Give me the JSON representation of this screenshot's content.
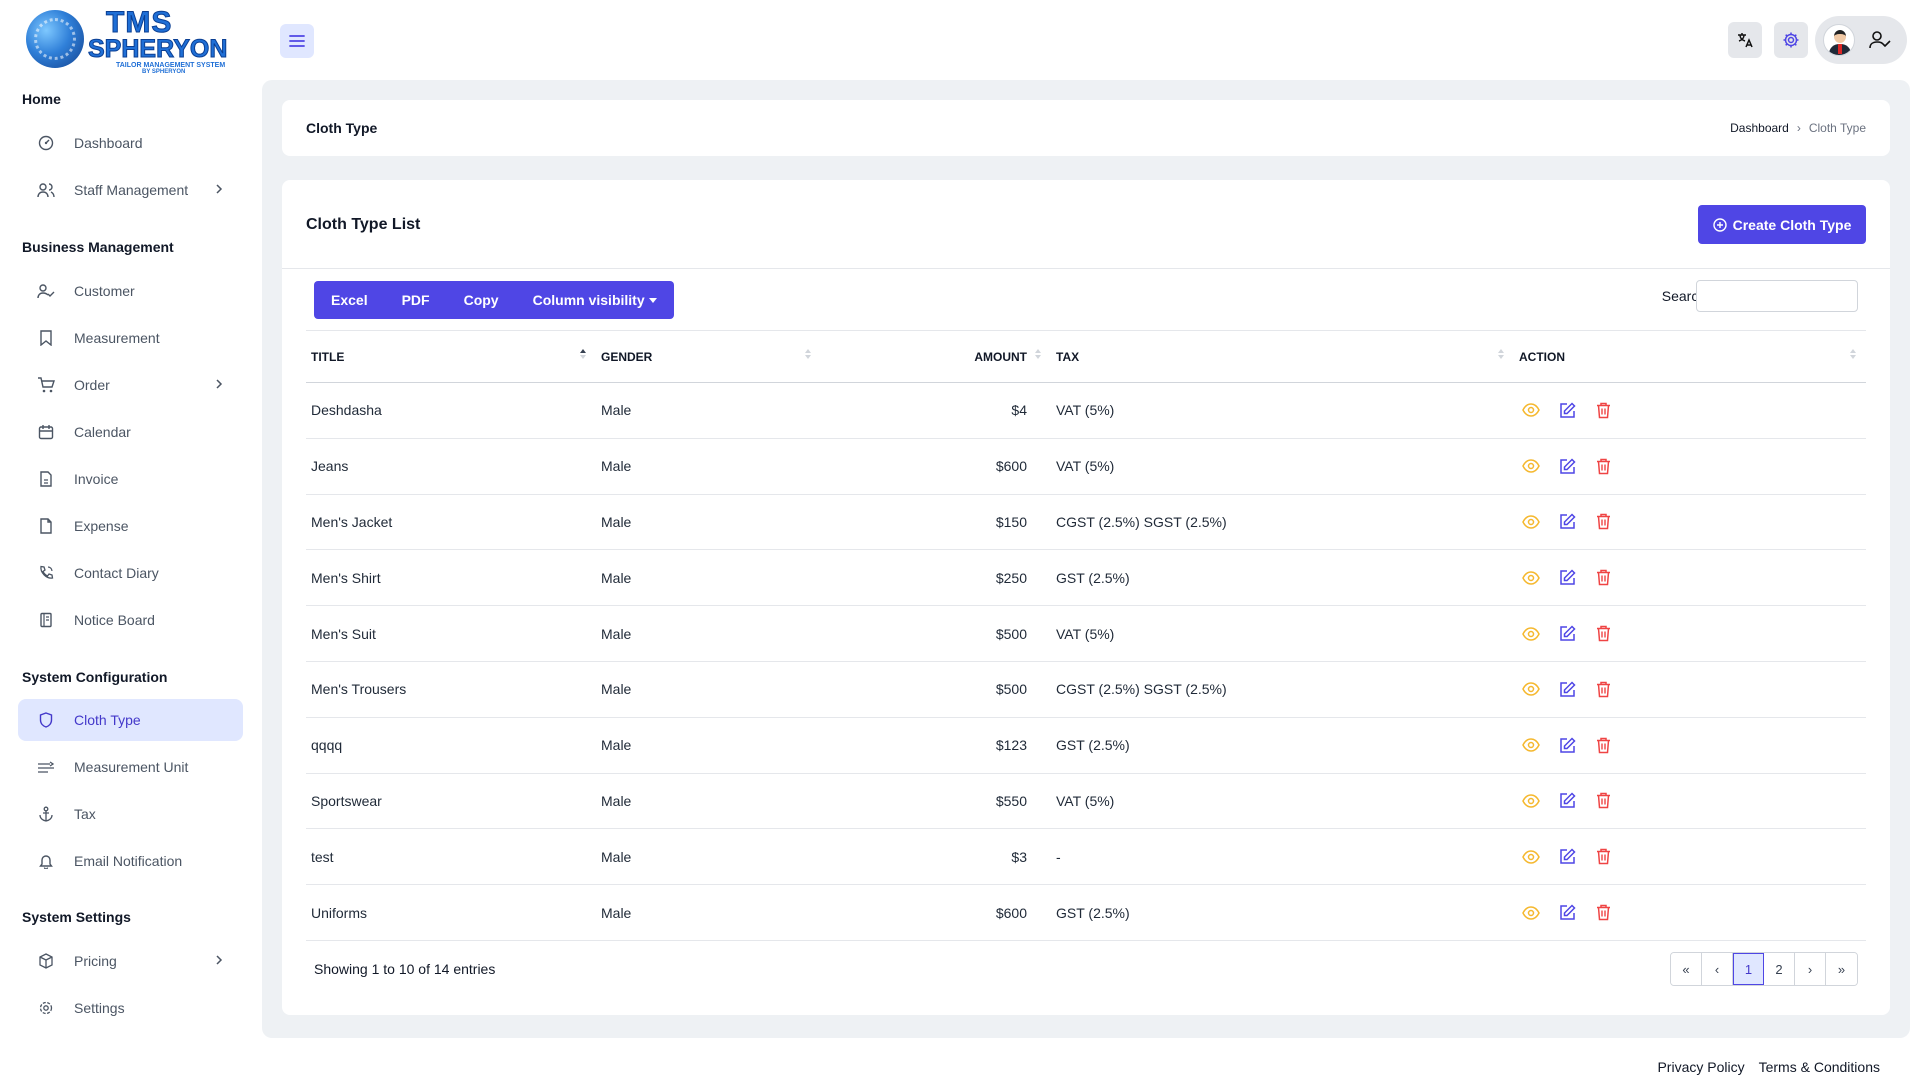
{
  "logo": {
    "title": "TMS",
    "subtitle": "SPHERYON",
    "tagline": "TAILOR MANAGEMENT SYSTEM",
    "byline": "BY SPHERYON"
  },
  "header": {
    "icons": [
      "menu-icon",
      "translate-icon",
      "gear-icon",
      "user-check-icon"
    ]
  },
  "sidebar": {
    "sections": [
      {
        "title": "Home",
        "items": [
          {
            "label": "Dashboard",
            "icon": "dashboard-icon"
          },
          {
            "label": "Staff Management",
            "icon": "users-icon",
            "has_submenu": true
          }
        ]
      },
      {
        "title": "Business Management",
        "items": [
          {
            "label": "Customer",
            "icon": "user-check-icon"
          },
          {
            "label": "Measurement",
            "icon": "bookmark-icon"
          },
          {
            "label": "Order",
            "icon": "cart-icon",
            "has_submenu": true
          },
          {
            "label": "Calendar",
            "icon": "calendar-icon"
          },
          {
            "label": "Invoice",
            "icon": "invoice-icon"
          },
          {
            "label": "Expense",
            "icon": "file-icon"
          },
          {
            "label": "Contact Diary",
            "icon": "phone-icon"
          },
          {
            "label": "Notice Board",
            "icon": "notice-icon"
          }
        ]
      },
      {
        "title": "System Configuration",
        "items": [
          {
            "label": "Cloth Type",
            "icon": "shield-icon",
            "active": true
          },
          {
            "label": "Measurement Unit",
            "icon": "ruler-icon"
          },
          {
            "label": "Tax",
            "icon": "anchor-icon"
          },
          {
            "label": "Email Notification",
            "icon": "bell-icon"
          }
        ]
      },
      {
        "title": "System Settings",
        "items": [
          {
            "label": "Pricing",
            "icon": "box-icon",
            "has_submenu": true
          },
          {
            "label": "Settings",
            "icon": "settings-icon"
          }
        ]
      }
    ]
  },
  "page": {
    "title": "Cloth Type",
    "breadcrumb": [
      "Dashboard",
      "Cloth Type"
    ]
  },
  "list": {
    "title": "Cloth Type List",
    "create_label": "Create Cloth Type",
    "export_buttons": [
      "Excel",
      "PDF",
      "Copy",
      "Column visibility"
    ],
    "search_label": "Search:",
    "search_value": "",
    "columns": [
      "TITLE",
      "GENDER",
      "AMOUNT",
      "TAX",
      "ACTION"
    ],
    "rows": [
      {
        "title": "Deshdasha",
        "gender": "Male",
        "amount": "$4",
        "tax": "VAT (5%)"
      },
      {
        "title": "Jeans",
        "gender": "Male",
        "amount": "$600",
        "tax": "VAT (5%)"
      },
      {
        "title": "Men's Jacket",
        "gender": "Male",
        "amount": "$150",
        "tax": "CGST (2.5%) SGST (2.5%)"
      },
      {
        "title": "Men's Shirt",
        "gender": "Male",
        "amount": "$250",
        "tax": "GST (2.5%)"
      },
      {
        "title": "Men's Suit",
        "gender": "Male",
        "amount": "$500",
        "tax": "VAT (5%)"
      },
      {
        "title": "Men's Trousers",
        "gender": "Male",
        "amount": "$500",
        "tax": "CGST (2.5%) SGST (2.5%)"
      },
      {
        "title": "qqqq",
        "gender": "Male",
        "amount": "$123",
        "tax": "GST (2.5%)"
      },
      {
        "title": "Sportswear",
        "gender": "Male",
        "amount": "$550",
        "tax": "VAT (5%)"
      },
      {
        "title": "test",
        "gender": "Male",
        "amount": "$3",
        "tax": "-"
      },
      {
        "title": "Uniforms",
        "gender": "Male",
        "amount": "$600",
        "tax": "GST (2.5%)"
      }
    ],
    "showing_text": "Showing 1 to 10 of 14 entries",
    "pagination": [
      "«",
      "‹",
      "1",
      "2",
      "›",
      "»"
    ],
    "current_page": "1"
  },
  "footer": {
    "links": [
      "Privacy Policy",
      "Terms & Conditions"
    ]
  },
  "colors": {
    "accent": "#4f46e5",
    "view": "#f5b82e",
    "edit": "#4f46e5",
    "delete": "#ef4444",
    "active_bg": "#e0e7ff"
  }
}
